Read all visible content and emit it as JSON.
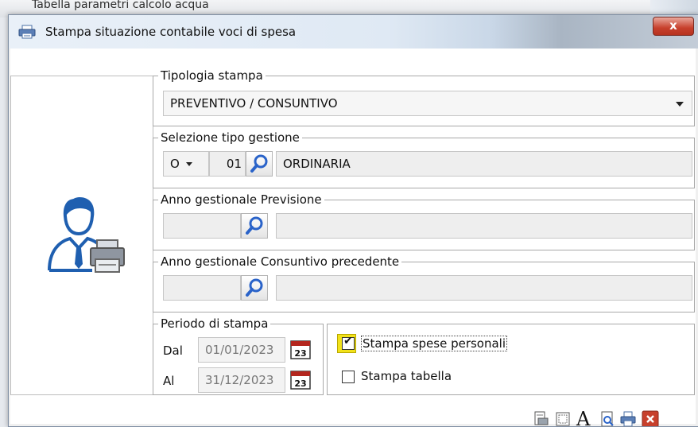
{
  "background": {
    "text": "Tabella parametri calcolo acqua"
  },
  "window": {
    "title": "Stampa situazione contabile voci di spesa",
    "close_label": "x"
  },
  "tipologia": {
    "legend": "Tipologia stampa",
    "value": "PREVENTIVO / CONSUNTIVO"
  },
  "gestione": {
    "legend": "Selezione tipo gestione",
    "type": "O",
    "code": "01",
    "description": "ORDINARIA"
  },
  "previsione": {
    "legend": "Anno gestionale Previsione",
    "year": "",
    "description": ""
  },
  "consuntivo": {
    "legend": "Anno gestionale Consuntivo precedente",
    "year": "",
    "description": ""
  },
  "periodo": {
    "legend": "Periodo di stampa",
    "dal_label": "Dal",
    "dal_value": "01/01/2023",
    "al_label": "Al",
    "al_value": "31/12/2023",
    "calendar_day": "23"
  },
  "options": {
    "spese_personali_label": "Stampa spese personali",
    "spese_personali_checked": true,
    "tabella_label": "Stampa tabella",
    "tabella_checked": false
  },
  "toolbar": {
    "font_label": "A"
  },
  "colors": {
    "accent": "#2a63c9",
    "close": "#c7402c",
    "calendar": "#b3261e"
  }
}
